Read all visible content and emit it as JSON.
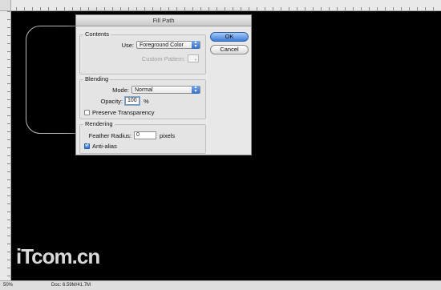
{
  "dialog": {
    "title": "Fill Path",
    "contents": {
      "title": "Contents",
      "use_label": "Use:",
      "use_value": "Foreground Color",
      "custom_pattern_label": "Custom Pattern:"
    },
    "blending": {
      "title": "Blending",
      "mode_label": "Mode:",
      "mode_value": "Normal",
      "opacity_label": "Opacity:",
      "opacity_value": "100",
      "opacity_unit": "%",
      "preserve_label": "Preserve Transparency",
      "preserve_checked": false
    },
    "rendering": {
      "title": "Rendering",
      "feather_label": "Feather Radius:",
      "feather_value": "0",
      "feather_unit": "pixels",
      "antialias_label": "Anti-alias",
      "antialias_checked": true
    },
    "buttons": {
      "ok": "OK",
      "cancel": "Cancel"
    }
  },
  "status": {
    "zoom": "50%",
    "doc": "Doc: 6.59M/41.7M"
  },
  "watermark": "iTcom.cn",
  "colors": {
    "canvas": "#000000",
    "accent": "#3d7ed8"
  },
  "icons": {
    "select_arrow": "updown-arrow-icon",
    "checkmark": "check-icon"
  }
}
